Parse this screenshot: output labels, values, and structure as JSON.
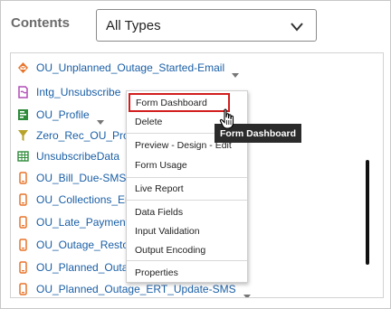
{
  "header": {
    "contents_label": "Contents",
    "type_select": {
      "value": "All Types"
    }
  },
  "items": [
    {
      "label": "OU_Unplanned_Outage_Started-Email",
      "icon": "email-template-icon",
      "color": "#e8742b"
    },
    {
      "label": "Intg_Unsubscribe",
      "icon": "integration-icon",
      "color": "#b04bb5"
    },
    {
      "label": "OU_Profile",
      "icon": "profile-form-icon",
      "color": "#2e8b3a"
    },
    {
      "label": "Zero_Rec_OU_Profile",
      "icon": "filter-icon",
      "color": "#b7a32a"
    },
    {
      "label": "UnsubscribeData",
      "icon": "data-table-icon",
      "color": "#2e8b3a"
    },
    {
      "label": "OU_Bill_Due-SMS",
      "icon": "sms-template-icon",
      "color": "#e8742b"
    },
    {
      "label": "OU_Collections_Ente",
      "icon": "sms-template-icon",
      "color": "#e8742b"
    },
    {
      "label": "OU_Late_Payment-S",
      "icon": "sms-template-icon",
      "color": "#e8742b"
    },
    {
      "label": "OU_Outage_Restore",
      "icon": "sms-template-icon",
      "color": "#e8742b"
    },
    {
      "label": "OU_Planned_Outage",
      "icon": "sms-template-icon",
      "color": "#e8742b"
    },
    {
      "label": "OU_Planned_Outage_ERT_Update-SMS",
      "icon": "sms-template-icon",
      "color": "#e8742b"
    }
  ],
  "context_menu": {
    "items": [
      "Form Dashboard",
      "Delete",
      "Preview - Design - Edit",
      "Form Usage",
      "Live Report",
      "Data Fields",
      "Input Validation",
      "Output Encoding",
      "Properties"
    ]
  },
  "tooltip": {
    "text": "Form Dashboard"
  },
  "colors": {
    "link": "#1a5fa6",
    "highlight_border": "#d21e1e",
    "tooltip_bg": "#2b2b2b"
  }
}
